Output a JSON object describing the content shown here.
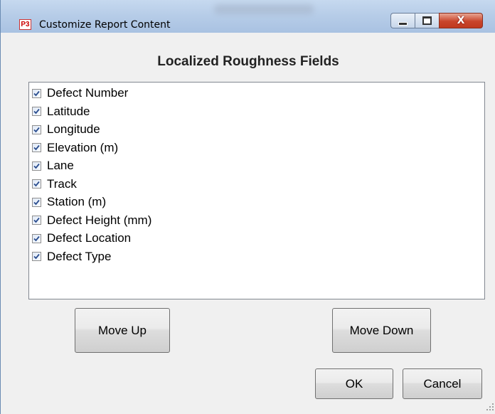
{
  "window": {
    "title": "Customize Report Content",
    "app_icon_text": "P3",
    "close_glyph": "X"
  },
  "heading": "Localized Roughness Fields",
  "fields": [
    {
      "label": "Defect Number",
      "checked": true
    },
    {
      "label": "Latitude",
      "checked": true
    },
    {
      "label": "Longitude",
      "checked": true
    },
    {
      "label": "Elevation (m)",
      "checked": true
    },
    {
      "label": "Lane",
      "checked": true
    },
    {
      "label": "Track",
      "checked": true
    },
    {
      "label": "Station (m)",
      "checked": true
    },
    {
      "label": "Defect Height (mm)",
      "checked": true
    },
    {
      "label": "Defect Location",
      "checked": true
    },
    {
      "label": "Defect Type",
      "checked": true
    }
  ],
  "buttons": {
    "move_up": "Move Up",
    "move_down": "Move Down",
    "ok": "OK",
    "cancel": "Cancel"
  }
}
